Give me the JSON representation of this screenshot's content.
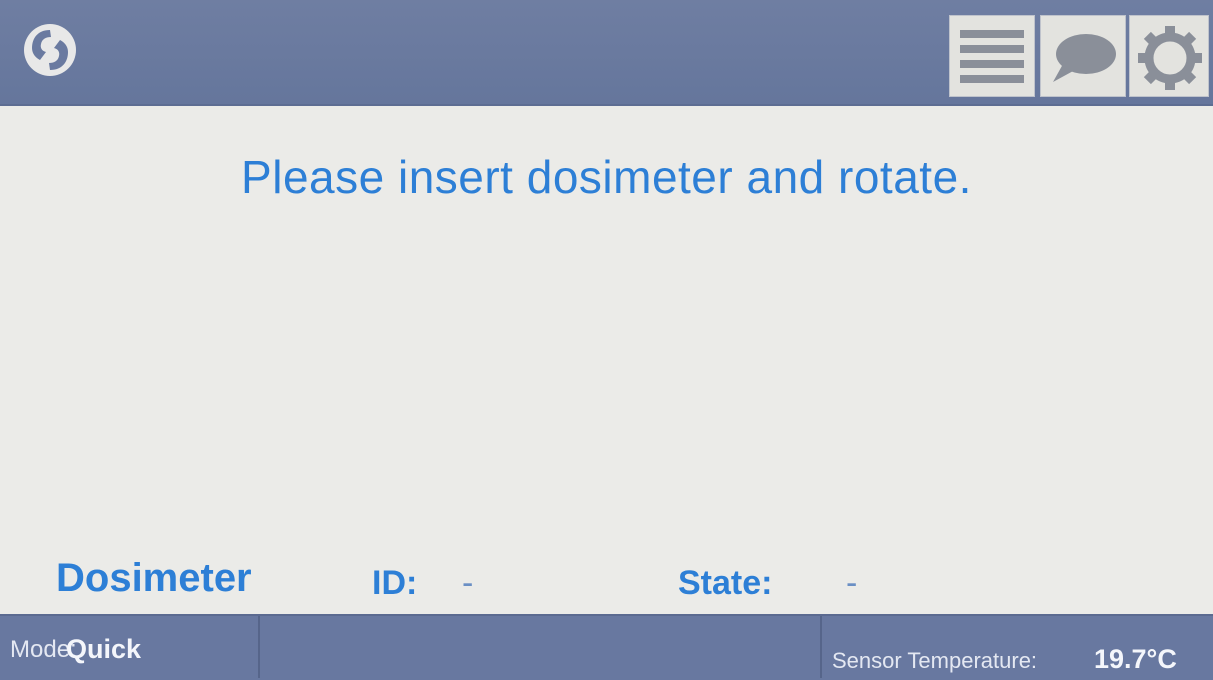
{
  "header": {
    "logo_icon": "app-logo-icon",
    "buttons": [
      {
        "name": "menu",
        "icon": "list-icon"
      },
      {
        "name": "messages",
        "icon": "speech-bubble-icon"
      },
      {
        "name": "settings",
        "icon": "gear-icon"
      }
    ]
  },
  "main": {
    "prompt": "Please insert dosimeter and rotate.",
    "dosimeter_label": "Dosimeter",
    "id_label": "ID:",
    "id_value": "-",
    "state_label": "State:",
    "state_value": "-"
  },
  "statusbar": {
    "mode_label": "Mode:",
    "mode_value": "Quick",
    "temp_label": "Sensor Temperature:",
    "temp_value": "19.7°C"
  },
  "colors": {
    "header_bg": "#6a7aa0",
    "accent_text": "#2d7fd6",
    "body_bg": "#ebebe8"
  }
}
